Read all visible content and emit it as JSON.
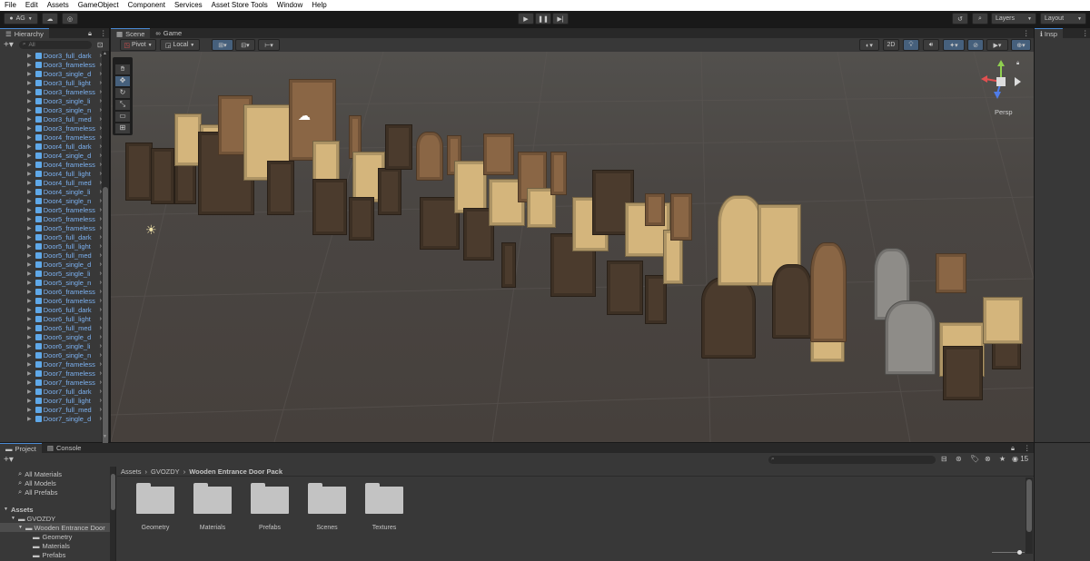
{
  "menu": [
    "File",
    "Edit",
    "Assets",
    "GameObject",
    "Component",
    "Services",
    "Asset Store Tools",
    "Window",
    "Help"
  ],
  "toolbar": {
    "account": "AG",
    "layers": "Layers",
    "layout": "Layout"
  },
  "hierarchy": {
    "tab": "Hierarchy",
    "search_placeholder": "All",
    "items": [
      "Door3_full_dark",
      "Door3_frameless",
      "Door3_single_d",
      "Door3_full_light",
      "Door3_frameless",
      "Door3_single_li",
      "Door3_single_n",
      "Door3_full_med",
      "Door3_frameless",
      "Door4_frameless",
      "Door4_full_dark",
      "Door4_single_d",
      "Door4_frameless",
      "Door4_full_light",
      "Door4_full_med",
      "Door4_single_li",
      "Door4_single_n",
      "Door5_frameless",
      "Door5_frameless",
      "Door5_frameless",
      "Door5_full_dark",
      "Door5_full_light",
      "Door5_full_med",
      "Door5_single_d",
      "Door5_single_li",
      "Door5_single_n",
      "Door6_frameless",
      "Door6_frameless",
      "Door6_full_dark",
      "Door6_full_light",
      "Door6_full_med",
      "Door6_single_d",
      "Door6_single_li",
      "Door6_single_n",
      "Door7_frameless",
      "Door7_frameless",
      "Door7_frameless",
      "Door7_full_dark",
      "Door7_full_light",
      "Door7_full_med",
      "Door7_single_d"
    ]
  },
  "scene": {
    "tabs": [
      "Scene",
      "Game"
    ],
    "pivot": "Pivot",
    "local": "Local",
    "mode_2d": "2D",
    "persp": "Persp",
    "colors": {
      "wood_dark": "#4b3b2d",
      "wood_light": "#d4b57c",
      "wood_mid": "#8a6645",
      "stone": "#8e8c88"
    }
  },
  "inspector": {
    "tab": "Insp"
  },
  "project": {
    "tabs": [
      "Project",
      "Console"
    ],
    "favorites": [
      "All Materials",
      "All Models",
      "All Prefabs"
    ],
    "tree": [
      "Assets",
      "GVOZDY",
      "Wooden Entrance Door",
      "Geometry",
      "Materials",
      "Prefabs"
    ],
    "breadcrumb": [
      "Assets",
      "GVOZDY",
      "Wooden Entrance Door Pack"
    ],
    "hidden_count": "15",
    "folders": [
      "Geometry",
      "Materials",
      "Prefabs",
      "Scenes",
      "Textures"
    ]
  }
}
